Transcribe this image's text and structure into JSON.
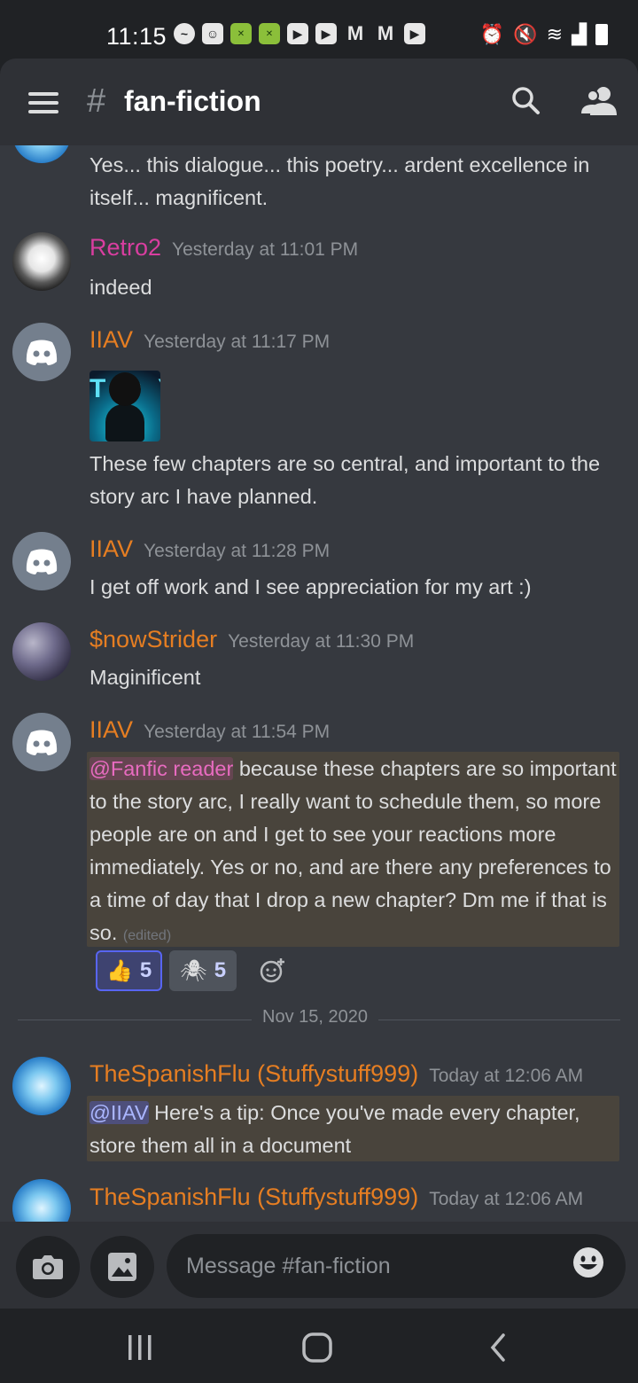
{
  "status_bar": {
    "time": "11:15",
    "icons": [
      "messenger-icon",
      "discord-icon",
      "game-icon",
      "game-icon",
      "youtube-icon",
      "youtube-icon",
      "gmail-icon",
      "gmail-icon",
      "youtube-icon"
    ],
    "right_icons": [
      "alarm-icon",
      "mute-icon",
      "wifi-icon",
      "signal-icon",
      "battery-icon"
    ]
  },
  "header": {
    "hash": "#",
    "channel": "fan-fiction"
  },
  "messages": [
    {
      "text": "Yes... this dialogue... this poetry... ardent excellence in itself... magnificent."
    },
    {
      "user": "Retro2",
      "time": "Yesterday at 11:01 PM",
      "text": "indeed"
    },
    {
      "user": "IIAV",
      "time": "Yesterday at 11:17 PM",
      "sticker_letters": "TOY",
      "text": "These few chapters are so central, and important to the story arc I have planned."
    },
    {
      "user": "IIAV",
      "time": "Yesterday at 11:28 PM",
      "text": "I get off work and I see appreciation for my art :)"
    },
    {
      "user": "$nowStrider",
      "time": "Yesterday at 11:30 PM",
      "text": "Maginificent"
    },
    {
      "user": "IIAV",
      "time": "Yesterday at 11:54 PM",
      "mention": "@Fanfic reader",
      "text": " because these chapters are so important to the story arc, I really want to schedule them, so more people are on and I get to see your reactions more immediately. Yes or no, and are there any preferences to a time of day that I drop a new chapter? Dm me if that is so. ",
      "edited": "(edited)",
      "reactions": [
        {
          "emoji": "👍",
          "count": "5"
        },
        {
          "emoji": "🕷",
          "count": "5"
        }
      ]
    },
    {
      "user": "TheSpanishFlu (Stuffystuff999)",
      "time": "Today at 12:06 AM",
      "mention": "@IIAV",
      "text": " Here's a tip: Once you've made every chapter, store them all in a document"
    },
    {
      "user": "TheSpanishFlu (Stuffystuff999)",
      "time": "Today at 12:06 AM"
    }
  ],
  "date_divider": "Nov 15, 2020",
  "composer": {
    "placeholder": "Message #fan-fiction"
  },
  "colors": {
    "background": "#36393f",
    "header": "#2f3136",
    "username_orange": "#e67e22",
    "username_pink": "#d93ea0",
    "mention_highlight": "#49443c"
  }
}
